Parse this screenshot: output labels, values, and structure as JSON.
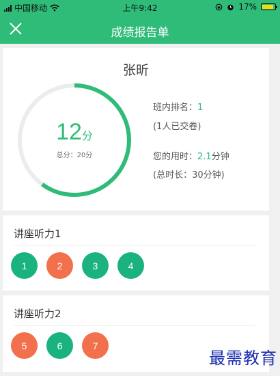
{
  "status_bar": {
    "carrier": "中国移动",
    "time": "上午9:42",
    "battery": "17%",
    "icons": [
      "signal-icon",
      "wifi-icon",
      "lock-rotation-icon",
      "alarm-icon",
      "battery-icon"
    ]
  },
  "nav": {
    "title": "成绩报告单",
    "close_icon": "close-icon"
  },
  "report": {
    "student_name": "张昕",
    "score": "12",
    "score_unit": "分",
    "total_label": "总分：20分",
    "score_fraction": 0.6,
    "rank_label": "班内排名：",
    "rank_value": "1",
    "submitted": "(1人已交卷)",
    "time_label": "您的用时：",
    "time_value": "2.1",
    "time_unit": "分钟",
    "total_time": "(总时长：30分钟)"
  },
  "sections": [
    {
      "title": "讲座听力1",
      "questions": [
        {
          "num": "1",
          "status": "correct"
        },
        {
          "num": "2",
          "status": "wrong"
        },
        {
          "num": "3",
          "status": "correct"
        },
        {
          "num": "4",
          "status": "correct"
        }
      ]
    },
    {
      "title": "讲座听力2",
      "questions": [
        {
          "num": "5",
          "status": "wrong"
        },
        {
          "num": "6",
          "status": "correct"
        },
        {
          "num": "7",
          "status": "wrong"
        }
      ]
    }
  ],
  "colors": {
    "accent": "#2fbb78",
    "correct": "#1ab27e",
    "wrong": "#f2704b",
    "ring_track": "#eaecee"
  },
  "watermark": "最需教育"
}
